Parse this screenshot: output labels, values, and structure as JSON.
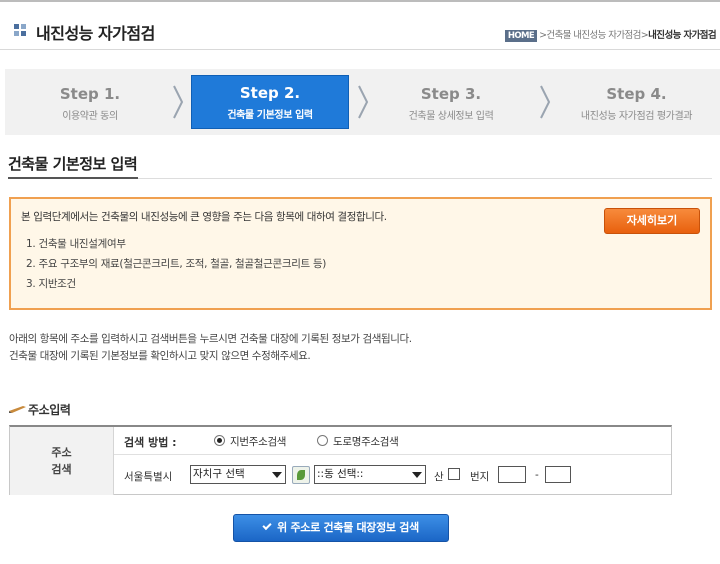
{
  "header": {
    "title": "내진성능 자가점검",
    "breadcrumb": {
      "home": "HOME",
      "middle": ">건축물 내진성능 자가점검>",
      "current": "내진성능 자가점검"
    }
  },
  "steps": [
    {
      "number": "Step 1.",
      "label": "이용약관 동의",
      "active": false
    },
    {
      "number": "Step 2.",
      "label": "건축물 기본정보 입력",
      "active": true
    },
    {
      "number": "Step 3.",
      "label": "건축물 상세정보 입력",
      "active": false
    },
    {
      "number": "Step 4.",
      "label": "내진성능 자가점검 평가결과",
      "active": false
    }
  ],
  "section": {
    "title": "건축물 기본정보 입력"
  },
  "notice": {
    "intro": "본 입력단계에서는 건축물의 내진성능에 큰 영향을 주는 다음 항목에 대하여 결정합니다.",
    "items": [
      "1. 건축물 내진설계여부",
      "2. 주요 구조부의 재료(철근콘크리트, 조적, 철골, 철골철근콘크리트 등)",
      "3. 지반조건"
    ],
    "detail_button": "자세히보기"
  },
  "description": {
    "line1": "아래의 항목에 주소를 입력하시고 검색버튼을 누르시면 건축물 대장에 기록된 정보가 검색됩니다.",
    "line2": "건축물 대장에 기록된 기본정보를 확인하시고 맞지 않으면 수정해주세요."
  },
  "address": {
    "title": "주소입력",
    "row_label_1": "주소",
    "row_label_2": "검색",
    "method_label": "검색 방법 :",
    "options": [
      {
        "label": "지번주소검색",
        "selected": true
      },
      {
        "label": "도로명주소검색",
        "selected": false
      }
    ],
    "city": "서울특별시",
    "district_select": "자치구 선택",
    "dong_select": "::동 선택::",
    "san_label": "산",
    "bunji_label": "번지",
    "dash": "-"
  },
  "search_button": "위 주소로 건축물 대장정보 검색"
}
